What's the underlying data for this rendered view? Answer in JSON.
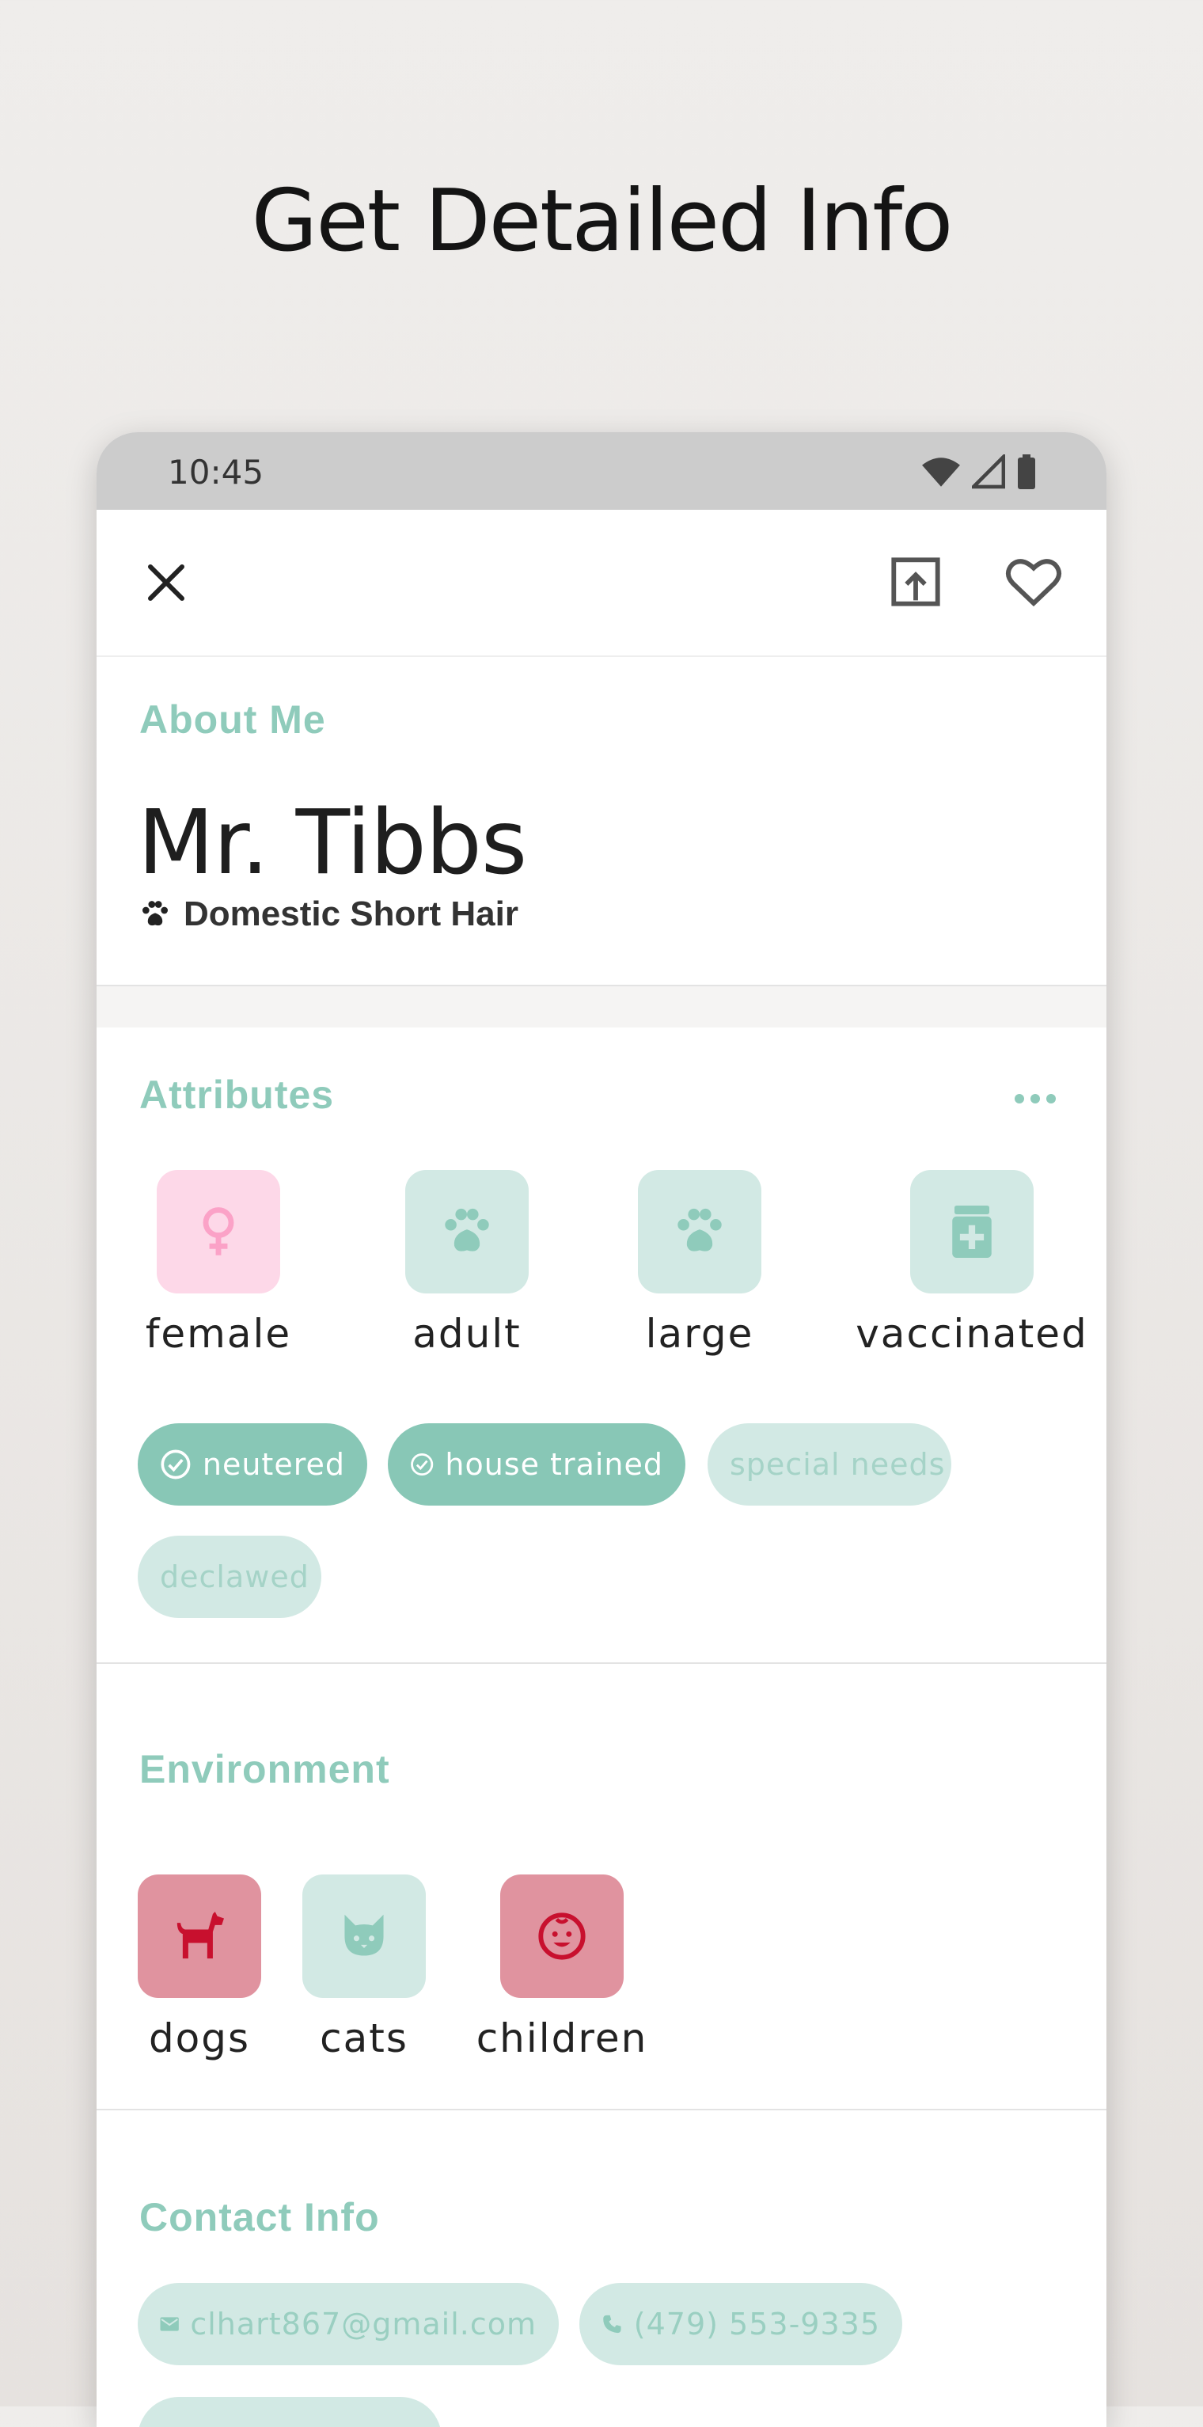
{
  "headline": "Get Detailed Info",
  "status": {
    "time": "10:45"
  },
  "about": {
    "title": "About Me",
    "name": "Mr. Tibbs",
    "breed": "Domestic Short Hair"
  },
  "attributes": {
    "title": "Attributes",
    "items": [
      {
        "label": "female",
        "icon": "female-icon",
        "color": "#fdd8e8"
      },
      {
        "label": "adult",
        "icon": "paw-icon",
        "color": "#d2e9e4"
      },
      {
        "label": "large",
        "icon": "paw-icon",
        "color": "#d2e9e4"
      },
      {
        "label": "vaccinated",
        "icon": "medicine-icon",
        "color": "#d2e9e4"
      }
    ],
    "chips": [
      {
        "label": "neutered",
        "active": true
      },
      {
        "label": "house trained",
        "active": true
      },
      {
        "label": "special needs",
        "active": false
      },
      {
        "label": "declawed",
        "active": false
      }
    ]
  },
  "environment": {
    "title": "Environment",
    "items": [
      {
        "label": "dogs",
        "icon": "dog-icon",
        "color": "#e0939f"
      },
      {
        "label": "cats",
        "icon": "cat-icon",
        "color": "#d2e9e4"
      },
      {
        "label": "children",
        "icon": "child-icon",
        "color": "#e0939f"
      }
    ]
  },
  "contact": {
    "title": "Contact Info",
    "email": "clhart867@gmail.com",
    "phone": "(479) 553-9335"
  },
  "colors": {
    "accent": "#8fcbbb",
    "chip_on": "#88c7b6",
    "chip_off": "#d2e9e4",
    "alert": "#e0939f",
    "alert_icon": "#c8102e",
    "female": "#fdd8e8"
  }
}
